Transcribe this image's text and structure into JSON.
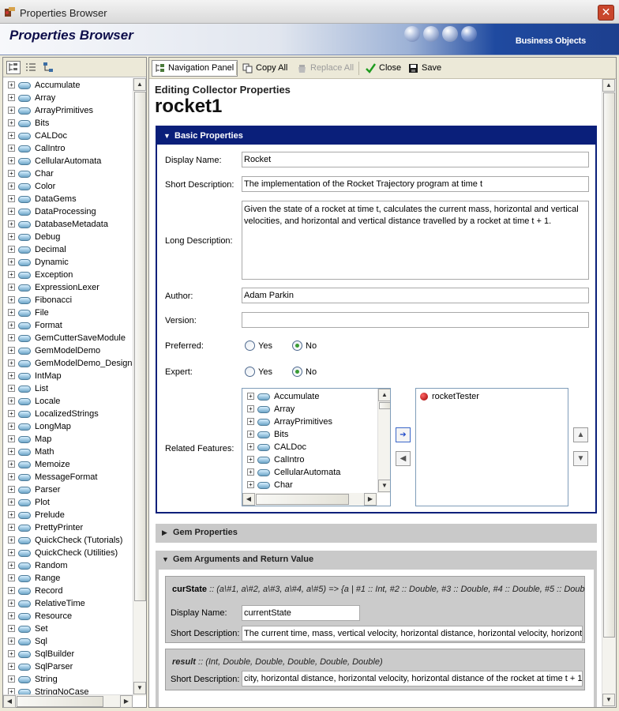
{
  "window": {
    "title": "Properties Browser",
    "close_glyph": "✕"
  },
  "banner": {
    "title": "Properties Browser",
    "brand": "Business Objects"
  },
  "left_toolbar": {
    "icons": [
      "tree-view-icon",
      "list-view-icon",
      "hierarchy-view-icon"
    ]
  },
  "modules": [
    "Accumulate",
    "Array",
    "ArrayPrimitives",
    "Bits",
    "CALDoc",
    "CalIntro",
    "CellularAutomata",
    "Char",
    "Color",
    "DataGems",
    "DataProcessing",
    "DatabaseMetadata",
    "Debug",
    "Decimal",
    "Dynamic",
    "Exception",
    "ExpressionLexer",
    "Fibonacci",
    "File",
    "Format",
    "GemCutterSaveModule",
    "GemModelDemo",
    "GemModelDemo_Designs",
    "IntMap",
    "List",
    "Locale",
    "LocalizedStrings",
    "LongMap",
    "Map",
    "Math",
    "Memoize",
    "MessageFormat",
    "Parser",
    "Plot",
    "Prelude",
    "PrettyPrinter",
    "QuickCheck (Tutorials)",
    "QuickCheck (Utilities)",
    "Random",
    "Range",
    "Record",
    "RelativeTime",
    "Resource",
    "Set",
    "Sql",
    "SqlBuilder",
    "SqlParser",
    "String",
    "StringNoCase"
  ],
  "toolbar": {
    "navigation_panel": "Navigation Panel",
    "copy_all": "Copy All",
    "replace_all": "Replace All",
    "close": "Close",
    "save": "Save"
  },
  "header": {
    "editing": "Editing Collector Properties",
    "name": "rocket1"
  },
  "basic": {
    "title": "Basic Properties",
    "display_name_label": "Display Name:",
    "display_name": "Rocket",
    "short_desc_label": "Short Description:",
    "short_desc": "The implementation of the Rocket Trajectory program at time t",
    "long_desc_label": "Long Description:",
    "long_desc": "Given the state of a rocket at time t, calculates the current mass, horizontal and vertical velocities, and horizontal and vertical distance travelled by a rocket at time t + 1.",
    "author_label": "Author:",
    "author": "Adam Parkin",
    "version_label": "Version:",
    "version": "",
    "preferred_label": "Preferred:",
    "expert_label": "Expert:",
    "yes": "Yes",
    "no": "No",
    "preferred_value": "No",
    "expert_value": "No",
    "related_label": "Related Features:",
    "available_features": [
      "Accumulate",
      "Array",
      "ArrayPrimitives",
      "Bits",
      "CALDoc",
      "CalIntro",
      "CellularAutomata",
      "Char"
    ],
    "selected_features": [
      "rocketTester"
    ]
  },
  "gem_props": {
    "title": "Gem Properties"
  },
  "gem_args": {
    "title": "Gem Arguments and Return Value",
    "arg1": {
      "name": "curState",
      "type": " :: (a\\#1, a\\#2, a\\#3, a\\#4, a\\#5) => {a | #1 :: Int, #2 :: Double, #3 :: Double, #4 :: Double, #5 :: Doub",
      "display_name_label": "Display Name:",
      "display_name": "currentState",
      "short_desc_label": "Short Description:",
      "short_desc": "The current time, mass, vertical velocity, horizontal distance, horizontal velocity, horizontal"
    },
    "result": {
      "name": "result",
      "type": " :: (Int, Double, Double, Double, Double, Double)",
      "short_desc_label": "Short Description:",
      "short_desc": "city, horizontal distance, horizontal velocity, horizontal distance of the rocket at time t + 1"
    }
  }
}
